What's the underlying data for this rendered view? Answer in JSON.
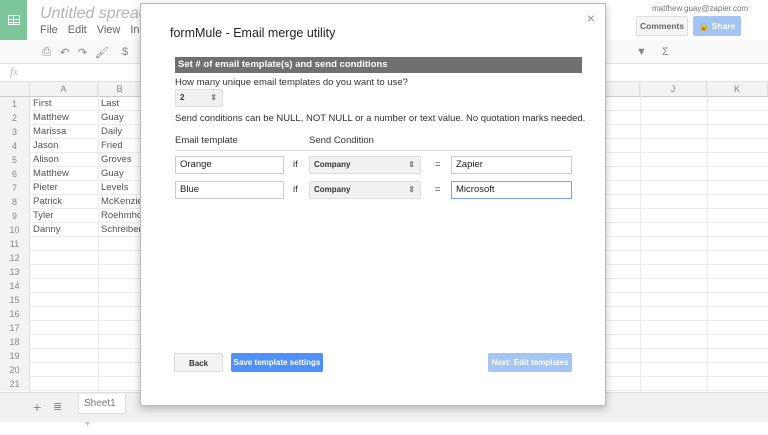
{
  "app": {
    "doc_title": "Untitled spreadsheet",
    "menu": [
      "File",
      "Edit",
      "View",
      "Insert"
    ],
    "account": "matthew.guay@zapier.com",
    "comments_label": "Comments",
    "share_label": "Share",
    "fx_label": "fx",
    "toolbar_currency": "$",
    "toolbar_sigma": "Σ"
  },
  "sheet": {
    "columns": [
      "A",
      "B",
      "J",
      "K"
    ],
    "rows": [
      [
        "First",
        "Last"
      ],
      [
        "Matthew",
        "Guay"
      ],
      [
        "Marissa",
        "Daily"
      ],
      [
        "Jason",
        "Fried"
      ],
      [
        "Alison",
        "Groves"
      ],
      [
        "Matthew",
        "Guay"
      ],
      [
        "Pieter",
        "Levels"
      ],
      [
        "Patrick",
        "McKenzie"
      ],
      [
        "Tyler",
        "Roehmholdt"
      ],
      [
        "Danny",
        "Schreiber"
      ]
    ],
    "row_numbers": [
      "1",
      "2",
      "3",
      "4",
      "5",
      "6",
      "7",
      "8",
      "9",
      "10",
      "11",
      "12",
      "13",
      "14",
      "15",
      "16",
      "17",
      "18",
      "19",
      "20",
      "21"
    ],
    "tab": "Sheet1"
  },
  "modal": {
    "title": "formMule - Email merge utility",
    "section": "Set # of email template(s) and send conditions",
    "question": "How many unique email templates do you want to use?",
    "template_count": "2",
    "hint": "Send conditions can be NULL, NOT NULL or a number or text value. No quotation marks needed.",
    "col_template": "Email template",
    "col_condition": "Send Condition",
    "rules": [
      {
        "template": "Orange",
        "if": "if",
        "field": "Company",
        "eq": "=",
        "value": "Zapier"
      },
      {
        "template": "Blue",
        "if": "if",
        "field": "Company",
        "eq": "=",
        "value": "Microsoft"
      }
    ],
    "back": "Back",
    "save": "Save template settings",
    "next": "Next: Edit templates",
    "close": "×"
  },
  "colors": {
    "accent": "#4d90fe",
    "disabled": "#a4c4f4",
    "header": "#707070",
    "logo": "#7cc69a"
  }
}
